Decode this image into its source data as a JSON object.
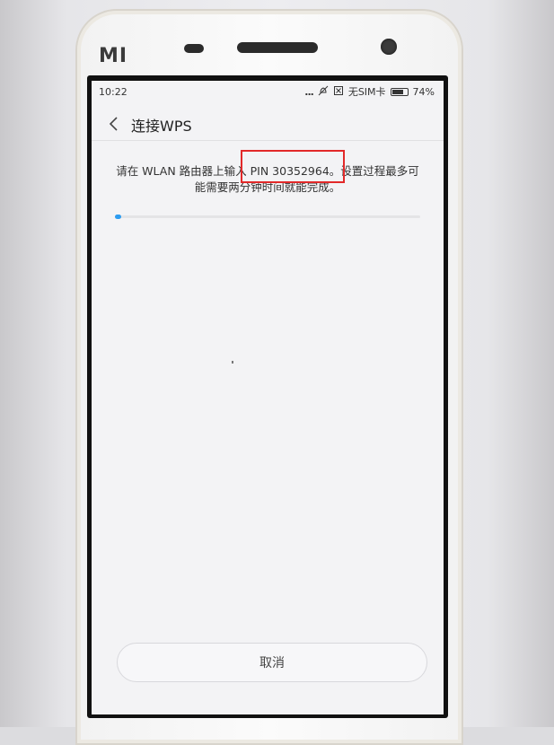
{
  "device": {
    "brand_logo": "MI"
  },
  "status_bar": {
    "time": "10:22",
    "overflow_dots": "...",
    "sim_status": "无SIM卡",
    "battery_percent": "74%",
    "battery_level": 0.74,
    "icons": [
      "do-not-disturb-icon",
      "no-sim-icon",
      "battery-icon"
    ]
  },
  "app_bar": {
    "title": "连接WPS",
    "back_icon": "chevron-left-icon"
  },
  "main": {
    "message_line1": "请在 WLAN 路由器上输入 PIN 30352964。设置过程最多可",
    "message_line2": "能需要两分钟时间就能完成。",
    "progress_value": 0.02,
    "progress_color": "#2d9cf0"
  },
  "footer": {
    "cancel_label": "取消"
  },
  "annotation": {
    "highlight_color": "#e22929"
  }
}
